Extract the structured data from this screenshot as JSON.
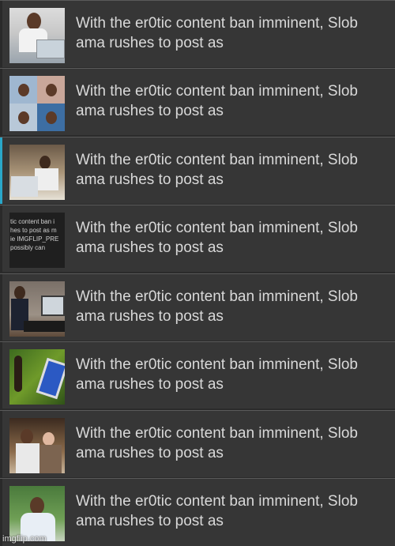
{
  "items": [
    {
      "title": "With the er0tic content ban imminent, Slob\nama rushes to post as",
      "thumb": "obama-laptop-thumbnail"
    },
    {
      "title": "With the er0tic content ban imminent, Slob\nama rushes to post as",
      "thumb": "obama-grid-thumbnail"
    },
    {
      "title": "With the er0tic content ban imminent, Slob\nama rushes to post as",
      "thumb": "obama-computer-thumbnail"
    },
    {
      "title": "With the er0tic content ban imminent, Slob\nama rushes to post as",
      "thumb": "text-screenshot-thumbnail",
      "thumb_text": [
        "tic content ban i",
        "hes to post as m",
        "ie IMGFLIP_PRE",
        "possibly can"
      ]
    },
    {
      "title": "With the er0tic content ban imminent, Slob\nama rushes to post as",
      "thumb": "obama-desk-thumbnail"
    },
    {
      "title": "With the er0tic content ban imminent, Slob\nama rushes to post as",
      "thumb": "phone-thumbnail"
    },
    {
      "title": "With the er0tic content ban imminent, Slob\nama rushes to post as",
      "thumb": "obama-group-thumbnail"
    },
    {
      "title": "With the er0tic content ban imminent, Slob\nama rushes to post as",
      "thumb": "obama-outdoor-thumbnail"
    }
  ],
  "watermark": "imgflip.com",
  "colors": {
    "row_bg": "#363636",
    "divider": "#5a5a5a",
    "text": "#d9d9d9"
  }
}
